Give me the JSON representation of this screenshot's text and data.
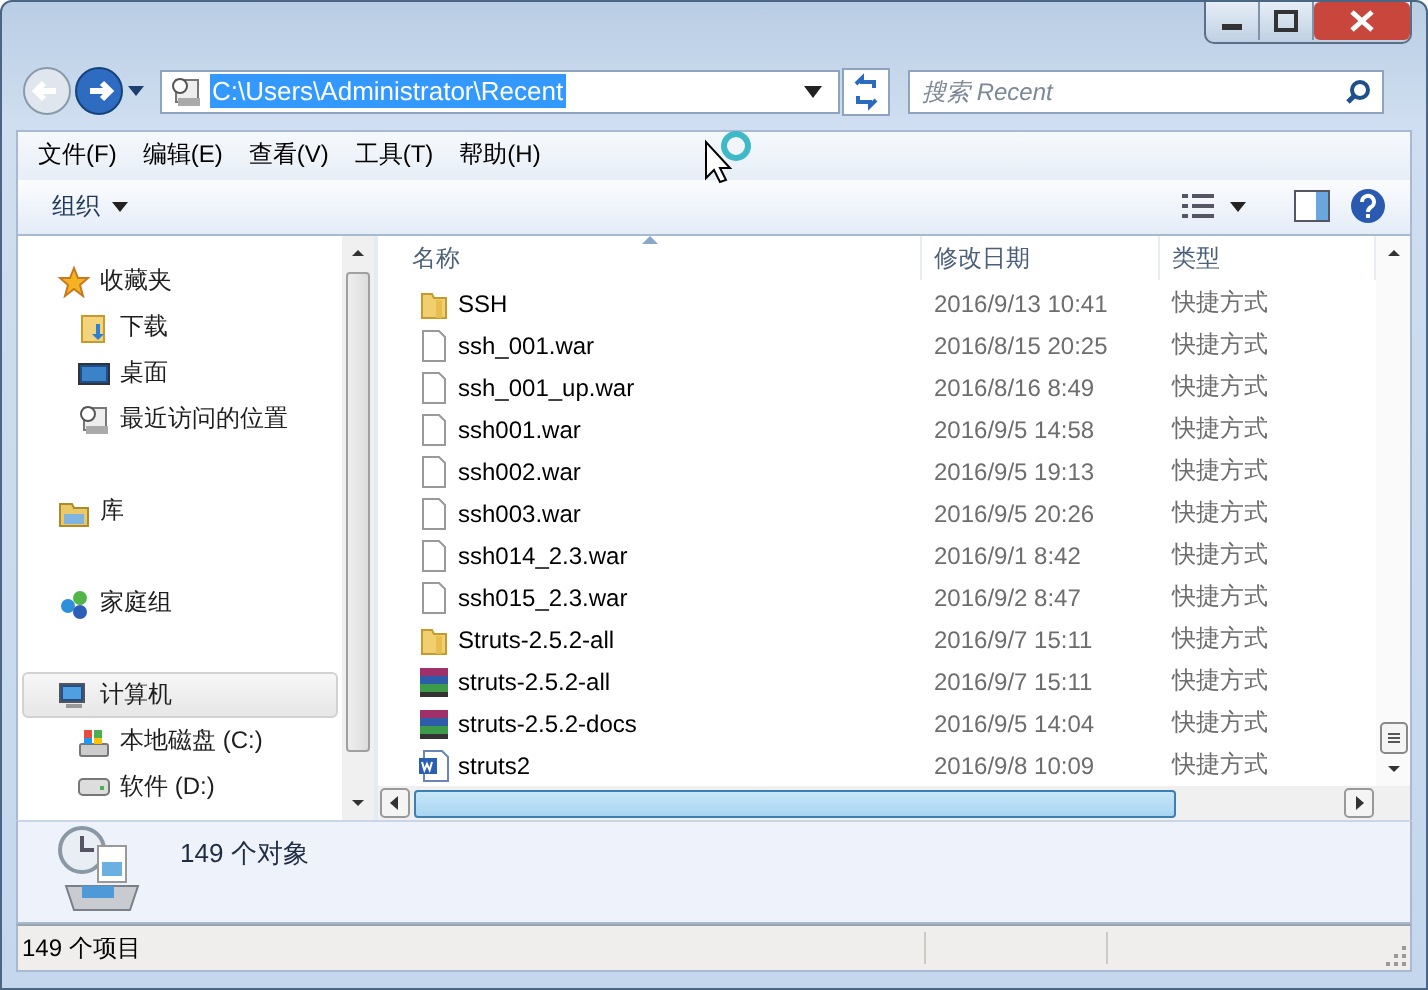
{
  "address": {
    "value": "C:\\Users\\Administrator\\Recent",
    "selected": true
  },
  "search": {
    "placeholder": "搜索 Recent"
  },
  "menu": [
    "文件(F)",
    "编辑(E)",
    "查看(V)",
    "工具(T)",
    "帮助(H)"
  ],
  "toolbar": {
    "organize": "组织"
  },
  "sidebar": [
    {
      "label": "收藏夹",
      "kind": "star",
      "selected": false,
      "children": [
        {
          "label": "下载",
          "kind": "download",
          "selected": false
        },
        {
          "label": "桌面",
          "kind": "desktop",
          "selected": false
        },
        {
          "label": "最近访问的位置",
          "kind": "recent",
          "selected": false
        }
      ]
    },
    {
      "label": "库",
      "kind": "library",
      "selected": false
    },
    {
      "label": "家庭组",
      "kind": "homegroup",
      "selected": false
    },
    {
      "label": "计算机",
      "kind": "computer",
      "selected": true,
      "children": [
        {
          "label": "本地磁盘 (C:)",
          "kind": "systemdrive",
          "selected": false
        },
        {
          "label": "软件 (D:)",
          "kind": "drive",
          "selected": false
        }
      ]
    }
  ],
  "columns": [
    {
      "label": "名称",
      "sorted": true
    },
    {
      "label": "修改日期",
      "sorted": false
    },
    {
      "label": "类型",
      "sorted": false
    }
  ],
  "rows": [
    {
      "name": "SSH",
      "date": "2016/9/13 10:41",
      "type": "快捷方式",
      "kind": "folder"
    },
    {
      "name": "ssh_001.war",
      "date": "2016/8/15 20:25",
      "type": "快捷方式",
      "kind": "file"
    },
    {
      "name": "ssh_001_up.war",
      "date": "2016/8/16 8:49",
      "type": "快捷方式",
      "kind": "file"
    },
    {
      "name": "ssh001.war",
      "date": "2016/9/5 14:58",
      "type": "快捷方式",
      "kind": "file"
    },
    {
      "name": "ssh002.war",
      "date": "2016/9/5 19:13",
      "type": "快捷方式",
      "kind": "file"
    },
    {
      "name": "ssh003.war",
      "date": "2016/9/5 20:26",
      "type": "快捷方式",
      "kind": "file"
    },
    {
      "name": "ssh014_2.3.war",
      "date": "2016/9/1 8:42",
      "type": "快捷方式",
      "kind": "file"
    },
    {
      "name": "ssh015_2.3.war",
      "date": "2016/9/2 8:47",
      "type": "快捷方式",
      "kind": "file"
    },
    {
      "name": "Struts-2.5.2-all",
      "date": "2016/9/7 15:11",
      "type": "快捷方式",
      "kind": "folder"
    },
    {
      "name": "struts-2.5.2-all",
      "date": "2016/9/7 15:11",
      "type": "快捷方式",
      "kind": "archive"
    },
    {
      "name": "struts-2.5.2-docs",
      "date": "2016/9/5 14:04",
      "type": "快捷方式",
      "kind": "archive"
    },
    {
      "name": "struts2",
      "date": "2016/9/8 10:09",
      "type": "快捷方式",
      "kind": "document"
    }
  ],
  "details": {
    "count": "149 个对象"
  },
  "status_bar": {
    "items": "149 个项目"
  }
}
